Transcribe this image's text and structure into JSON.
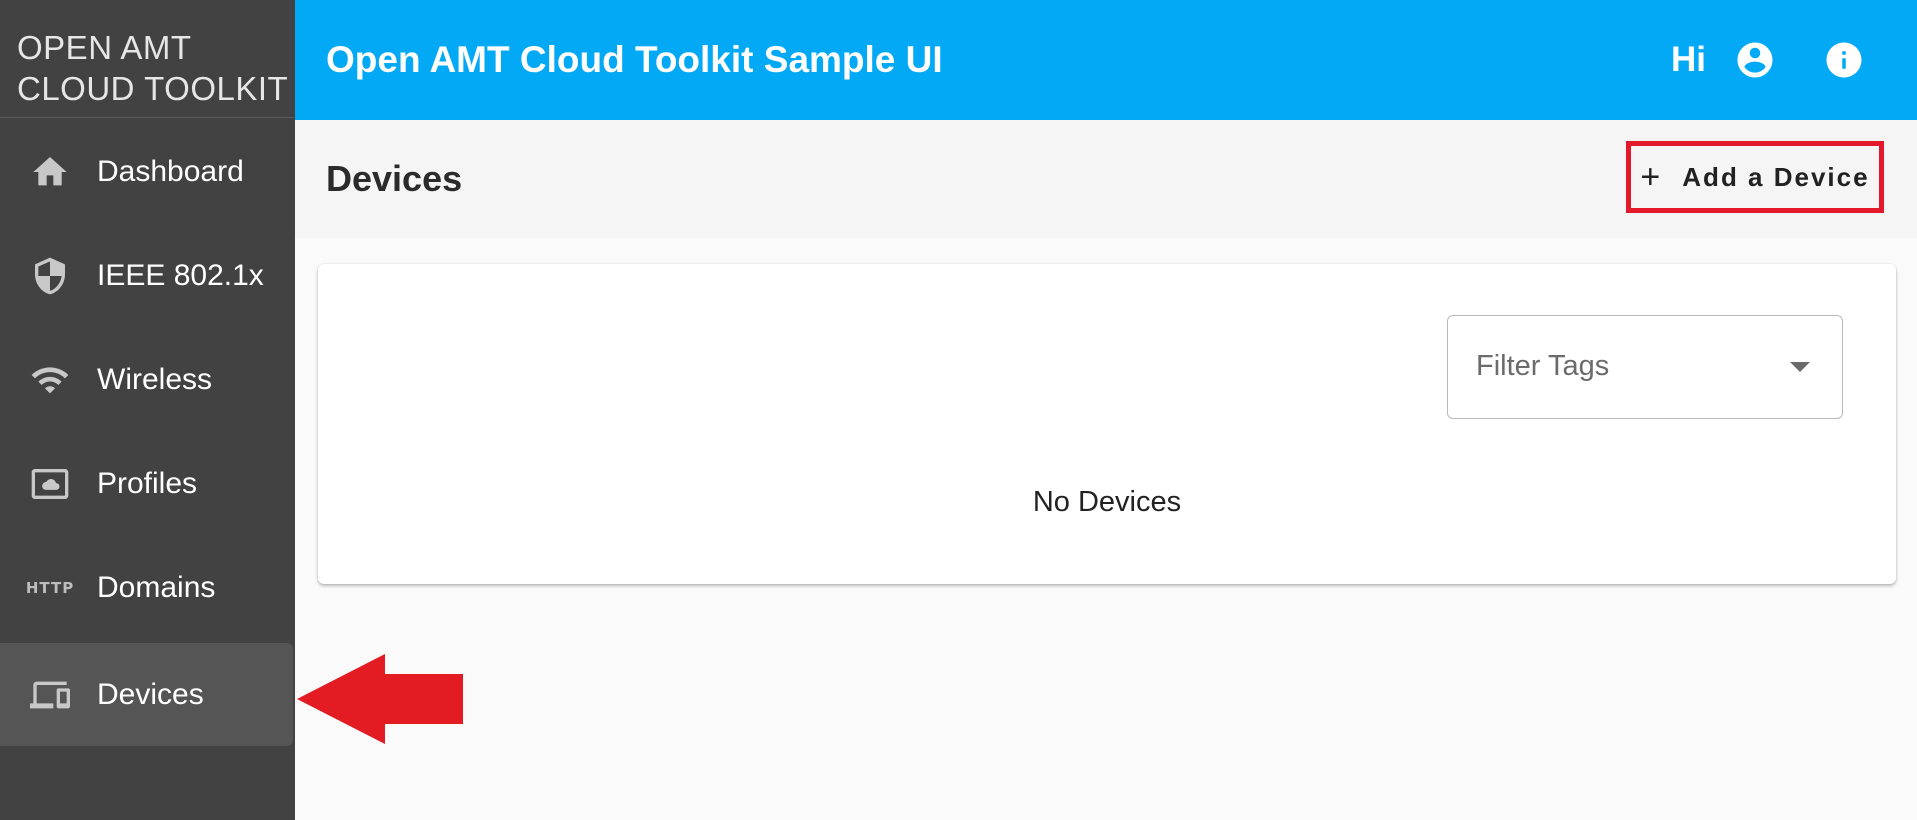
{
  "sidebar": {
    "logo_line1": "OPEN AMT",
    "logo_line2": "CLOUD TOOLKIT",
    "items": [
      {
        "label": "Dashboard",
        "icon": "home-icon"
      },
      {
        "label": "IEEE 802.1x",
        "icon": "shield-icon"
      },
      {
        "label": "Wireless",
        "icon": "wifi-icon"
      },
      {
        "label": "Profiles",
        "icon": "profile-cloud-icon"
      },
      {
        "label": "Domains",
        "icon": "http-icon",
        "icon_text": "HTTP"
      },
      {
        "label": "Devices",
        "icon": "devices-icon",
        "active": true
      }
    ]
  },
  "header": {
    "title": "Open AMT Cloud Toolkit Sample UI",
    "greeting": "Hi",
    "icons": [
      "account-circle-icon",
      "info-icon"
    ]
  },
  "page": {
    "title": "Devices",
    "add_button_label": "Add a Device",
    "add_button_icon": "+"
  },
  "card": {
    "filter_placeholder": "Filter Tags",
    "empty_message": "No Devices"
  },
  "colors": {
    "topbar": "#03a9f4",
    "sidebar": "#424242",
    "highlight": "#e3192b",
    "arrow": "#e31b23"
  }
}
